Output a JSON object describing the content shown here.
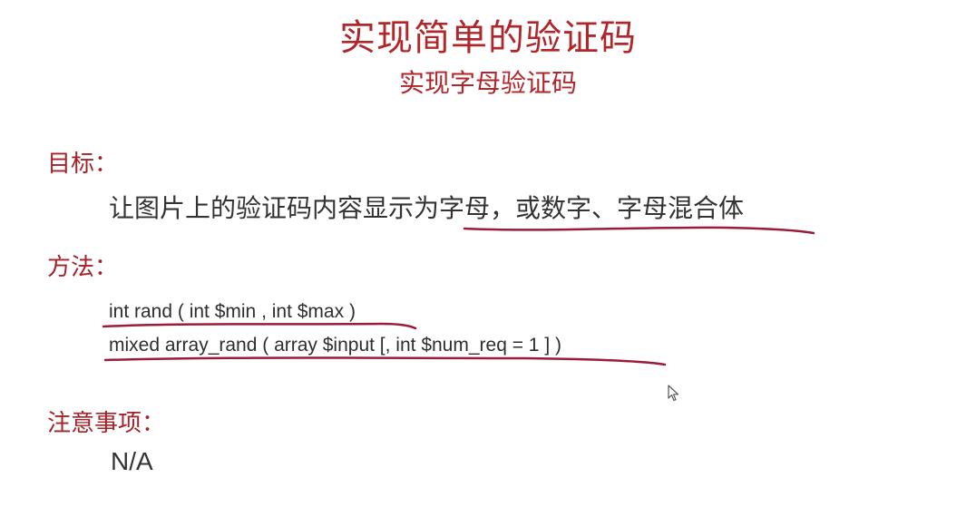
{
  "slide": {
    "title": "实现简单的验证码",
    "subtitle": "实现字母验证码",
    "goal": {
      "label": "目标：",
      "text": "让图片上的验证码内容显示为字母，或数字、字母混合体"
    },
    "method": {
      "label": "方法：",
      "lines": [
        "int rand ( int $min , int $max )",
        "mixed array_rand ( array $input [, int $num_req = 1 ] )"
      ]
    },
    "notes": {
      "label": "注意事项：",
      "text": "N/A"
    }
  },
  "colors": {
    "title": "#b1262a",
    "label": "#a52228",
    "underline": "#9b1c3a",
    "text": "#333333"
  },
  "icons": [
    "mouse-cursor-icon"
  ]
}
